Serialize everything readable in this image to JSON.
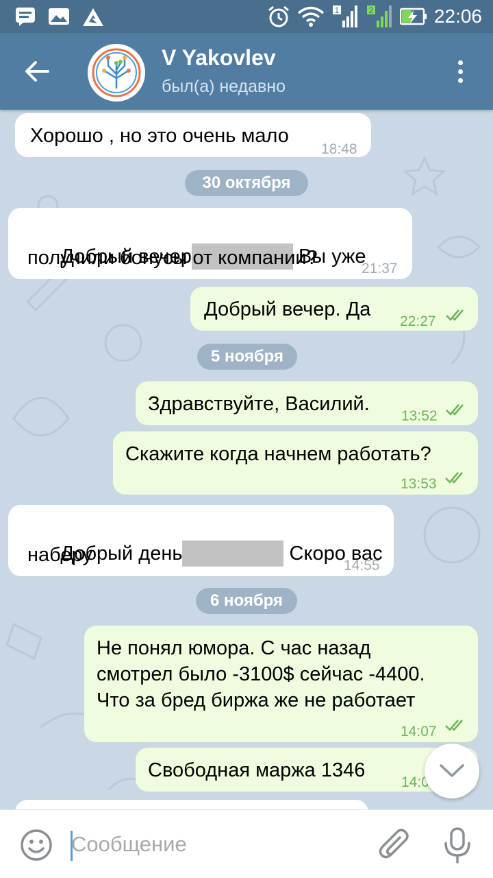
{
  "status_bar": {
    "time": "22:06",
    "sim1_label": "1",
    "sim2_label": "2",
    "icons": [
      "message-icon",
      "gallery-icon",
      "warning-icon",
      "alarm-icon",
      "wifi-icon",
      "signal-icon",
      "battery-charging-icon"
    ]
  },
  "header": {
    "title": "V Yakovlev",
    "status": "был(а) недавно",
    "back_icon": "arrow-back-icon",
    "menu_icon": "more-vert-icon"
  },
  "messages": [
    {
      "dir": "in",
      "text": "Хорошо , но это очень мало",
      "time": "18:48"
    },
    {
      "date": "30 октября"
    },
    {
      "dir": "in",
      "line1_a": "Добрый вечер",
      "line1_b": "Вы уже",
      "line2": "получили бонусы от компании?",
      "time": "21:37",
      "redacted": true
    },
    {
      "dir": "out",
      "text": "Добрый вечер. Да",
      "time": "22:27",
      "read": true
    },
    {
      "date": "5 ноября"
    },
    {
      "dir": "out",
      "text": "Здравствуйте, Василий.",
      "time": "13:52",
      "read": true
    },
    {
      "dir": "out",
      "text": "Скажите когда начнем работать?",
      "time": "13:53",
      "read": true
    },
    {
      "dir": "in",
      "line1_a": "Добрый день",
      "line1_b": "Скоро вас",
      "line2": "наберу",
      "time": "14:55",
      "redacted": true
    },
    {
      "date": "6 ноября"
    },
    {
      "dir": "out",
      "line1": "Не понял юмора. С час назад",
      "line2": "смотрел было -3100$ сейчас -4400.",
      "line3": "Что за бред биржа же не работает",
      "time": "14:07",
      "read": true
    },
    {
      "dir": "out",
      "text": "Свободная маржа 1346",
      "time": "14:0",
      "read": true
    }
  ],
  "composer": {
    "placeholder": "Сообщение",
    "emoji_icon": "emoji-icon",
    "attach_icon": "paperclip-icon",
    "mic_icon": "microphone-icon"
  },
  "colors": {
    "statusbar": "#4a6e8e",
    "appbar": "#527da3",
    "chat_bg": "#c9d8e4",
    "bubble_in": "#ffffff",
    "bubble_out": "#effdde",
    "out_time": "#6cb45b"
  }
}
